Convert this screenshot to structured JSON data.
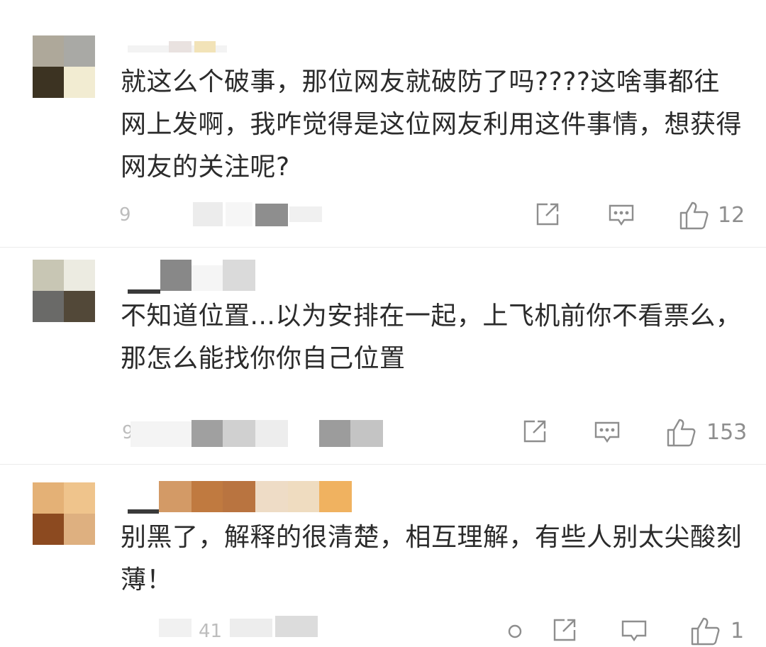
{
  "comments": [
    {
      "text": "就这么个破事，那位网友就破防了吗????这啥事都往网上发啊，我咋觉得是这位网友利用这件事情，想获得网友的关注呢?",
      "meta_prefix": "9",
      "likes": "12",
      "avatar_colors": [
        "#aea89a",
        "#a9a9a5",
        "#3c3322",
        "#f2ecd2"
      ]
    },
    {
      "text": "不知道位置...以为安排在一起，上飞机前你不看票么，那怎么能找你你自己位置",
      "meta_prefix": "9",
      "likes": "153",
      "avatar_colors": [
        "#c8c6b4",
        "#ecebe1",
        "#6a6a68",
        "#524838"
      ]
    },
    {
      "text": "别黑了，解释的很清楚，相互理解，有些人别太尖酸刻薄！",
      "meta_prefix": "41",
      "likes": "1",
      "avatar_colors": [
        "#e4b176",
        "#efc48c",
        "#8c4a20",
        "#deb080"
      ]
    }
  ],
  "icons": {
    "repost": "share-edit-icon",
    "reply": "comment-bubble-icon",
    "like": "thumbs-up-icon"
  },
  "colors": {
    "text": "#2b2b2b",
    "icon": "#8e8e8e",
    "meta": "#bdbdbd"
  }
}
